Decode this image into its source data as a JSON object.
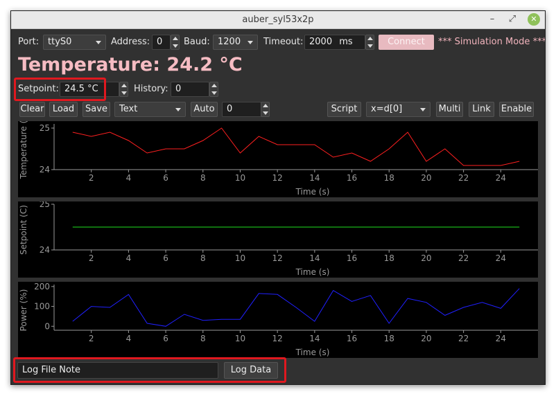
{
  "window": {
    "title": "auber_syl53x2p",
    "controls": [
      "–",
      "⤢",
      "✕"
    ]
  },
  "toolbar": {
    "port_label": "Port:",
    "port_value": "ttyS0",
    "address_label": "Address:",
    "address_value": "0",
    "baud_label": "Baud:",
    "baud_value": "1200",
    "timeout_label": "Timeout:",
    "timeout_value": "2000",
    "timeout_unit": "ms",
    "connect_label": "Connect",
    "mode_text": "*** Simulation Mode ***"
  },
  "temperature_text": "Temperature: 24.2 °C",
  "setpoint": {
    "label": "Setpoint:",
    "value": "24.5 °C",
    "history_label": "History:",
    "history_value": "0"
  },
  "actions": {
    "clear": "Clear",
    "load": "Load",
    "save": "Save",
    "format_value": "Text",
    "auto": "Auto",
    "auto_value": "0",
    "script": "Script",
    "expr_value": "x=d[0]",
    "multi": "Multi",
    "link": "Link",
    "enable": "Enable"
  },
  "log": {
    "note_placeholder": "Log File Note",
    "button": "Log Data"
  },
  "colors": {
    "temperature": "#ff2020",
    "setpoint": "#20e020",
    "power": "#2020ff",
    "accent": "#f6bcc3",
    "highlight": "#e0181f"
  },
  "chart_data": [
    {
      "type": "line",
      "xlabel": "Time (s)",
      "ylabel": "Temperature (",
      "xticks": [
        2,
        4,
        6,
        8,
        10,
        12,
        14,
        16,
        18,
        20,
        22,
        24
      ],
      "yticks": [
        24,
        25
      ],
      "xlim": [
        0,
        26
      ],
      "ylim": [
        24,
        25.1
      ],
      "grid": false,
      "series": [
        {
          "x": [
            1,
            2,
            3,
            4,
            5,
            6,
            7,
            8,
            9,
            10,
            11,
            12,
            13,
            14,
            15,
            16,
            17,
            18,
            19,
            20,
            21,
            22,
            23,
            24,
            25
          ],
          "values": [
            24.9,
            24.8,
            24.9,
            24.7,
            24.4,
            24.5,
            24.5,
            24.7,
            25.0,
            24.4,
            24.8,
            24.6,
            24.6,
            24.6,
            24.3,
            24.4,
            24.2,
            24.5,
            24.9,
            24.2,
            24.5,
            24.1,
            24.1,
            24.1,
            24.2
          ]
        }
      ]
    },
    {
      "type": "line",
      "xlabel": "Time (s)",
      "ylabel": "Setpoint (C)",
      "xticks": [
        2,
        4,
        6,
        8,
        10,
        12,
        14,
        16,
        18,
        20,
        22,
        24
      ],
      "yticks": [
        24,
        25
      ],
      "xlim": [
        0,
        26
      ],
      "ylim": [
        24,
        25
      ],
      "grid": false,
      "series": [
        {
          "x": [
            1,
            2,
            3,
            4,
            5,
            6,
            7,
            8,
            9,
            10,
            11,
            12,
            13,
            14,
            15,
            16,
            17,
            18,
            19,
            20,
            21,
            22,
            23,
            24,
            25
          ],
          "values": [
            24.5,
            24.5,
            24.5,
            24.5,
            24.5,
            24.5,
            24.5,
            24.5,
            24.5,
            24.5,
            24.5,
            24.5,
            24.5,
            24.5,
            24.5,
            24.5,
            24.5,
            24.5,
            24.5,
            24.5,
            24.5,
            24.5,
            24.5,
            24.5,
            24.5
          ]
        }
      ]
    },
    {
      "type": "line",
      "xlabel": "Time (s)",
      "ylabel": "Power (%)",
      "xticks": [
        2,
        4,
        6,
        8,
        10,
        12,
        14,
        16,
        18,
        20,
        22,
        24
      ],
      "yticks": [
        0,
        100,
        200
      ],
      "xlim": [
        0,
        26
      ],
      "ylim": [
        -20,
        210
      ],
      "grid": false,
      "series": [
        {
          "x": [
            1,
            2,
            3,
            4,
            5,
            6,
            7,
            8,
            9,
            10,
            11,
            12,
            13,
            14,
            15,
            16,
            17,
            18,
            19,
            20,
            21,
            22,
            23,
            24,
            25
          ],
          "values": [
            25,
            100,
            95,
            160,
            15,
            0,
            60,
            30,
            35,
            35,
            165,
            160,
            95,
            25,
            180,
            125,
            155,
            15,
            140,
            120,
            55,
            95,
            120,
            90,
            190
          ]
        }
      ]
    }
  ]
}
